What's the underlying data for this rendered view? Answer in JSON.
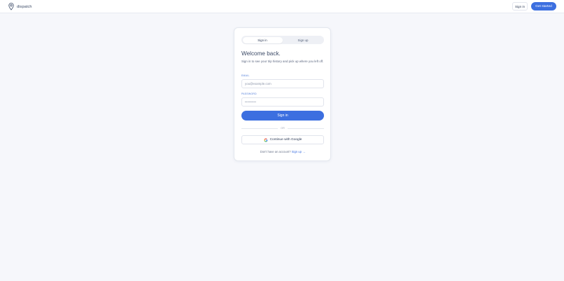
{
  "brand": {
    "name": "dispatch",
    "logo_icon": "map-pin-icon"
  },
  "header": {
    "signin_label": "Sign in",
    "get_started_label": "Get started"
  },
  "auth": {
    "tabs": [
      {
        "label": "Sign in",
        "active": true
      },
      {
        "label": "Sign up",
        "active": false
      }
    ],
    "title": "Welcome back.",
    "subtitle": "Sign in to see your trip history and pick up where you left off.",
    "email": {
      "label": "EMAIL",
      "placeholder": "you@example.com",
      "value": ""
    },
    "password": {
      "label": "PASSWORD",
      "masked_value": "••••••••"
    },
    "submit_label": "Sign in",
    "divider_text": "OR",
    "google_label": "Continue with Google",
    "footer": {
      "prompt": "Don't have an account?",
      "link": "Sign up →"
    }
  },
  "colors": {
    "accent": "#3c6fe0",
    "background": "#f6f7fb",
    "card": "#ffffff",
    "label": "#4a78d8"
  }
}
